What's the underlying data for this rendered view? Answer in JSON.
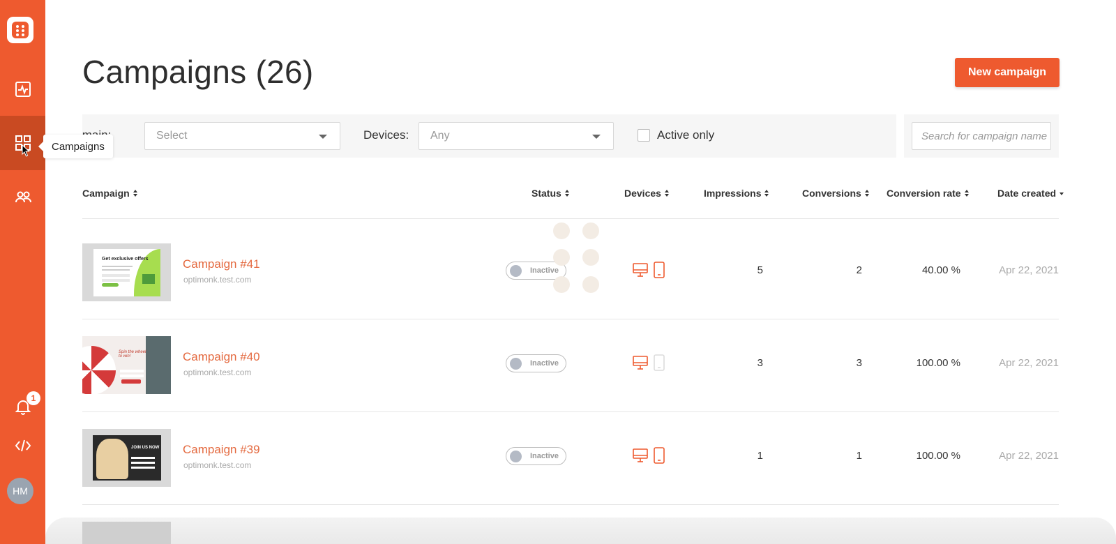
{
  "sidebar": {
    "tooltip": "Campaigns",
    "notification_count": "1",
    "avatar_initials": "HM",
    "icons": [
      "dashboard-icon",
      "campaigns-icon",
      "subscribers-icon",
      "bell-icon",
      "code-icon"
    ]
  },
  "header": {
    "title": "Campaigns (26)",
    "new_campaign_label": "New campaign"
  },
  "filters": {
    "domain_label": "Domain:",
    "domain_value": "Select",
    "devices_label": "Devices:",
    "devices_value": "Any",
    "active_only_label": "Active only",
    "search_placeholder": "Search for campaign name"
  },
  "table": {
    "columns": [
      "Campaign",
      "Status",
      "Devices",
      "Impressions",
      "Conversions",
      "Conversion rate",
      "Date created"
    ],
    "rows": [
      {
        "name": "Campaign #41",
        "domain": "optimonk.test.com",
        "status": "Inactive",
        "impressions": "5",
        "conversions": "2",
        "rate": "40.00 %",
        "date": "Apr 22, 2021",
        "thumb_title": "Get exclusive offers",
        "mobile_active": true
      },
      {
        "name": "Campaign #40",
        "domain": "optimonk.test.com",
        "status": "Inactive",
        "impressions": "3",
        "conversions": "3",
        "rate": "100.00 %",
        "date": "Apr 22, 2021",
        "thumb_title": "Spin the wheel to win!",
        "mobile_active": false
      },
      {
        "name": "Campaign #39",
        "domain": "optimonk.test.com",
        "status": "Inactive",
        "impressions": "1",
        "conversions": "1",
        "rate": "100.00 %",
        "date": "Apr 22, 2021",
        "thumb_title": "JOIN US NOW",
        "mobile_active": true
      }
    ]
  },
  "colors": {
    "brand": "#ee5a2f",
    "link": "#e4693f"
  }
}
